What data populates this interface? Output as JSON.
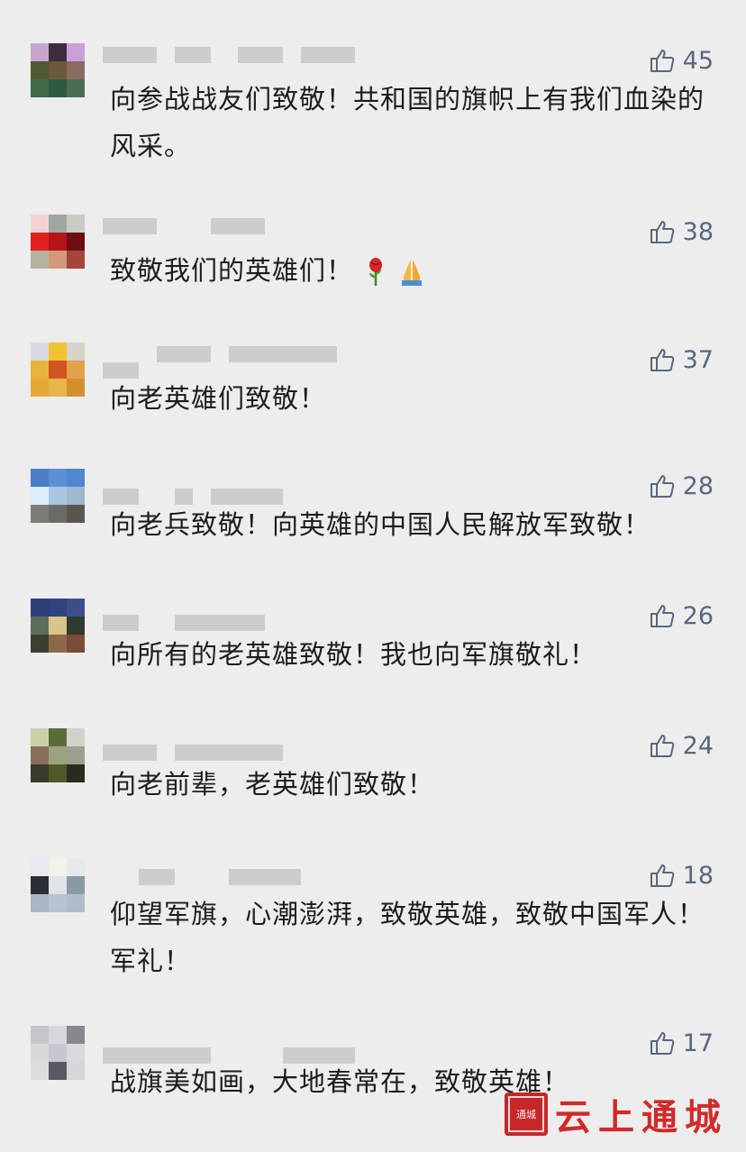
{
  "colors": {
    "background": "#ededed",
    "like": "#58667e",
    "text": "#1c1c1c",
    "watermark": "#d12a2a"
  },
  "comments": [
    {
      "likes": "45",
      "text": "向参战战友们致敬！共和国的旗帜上有我们血染的风采。",
      "emoji": []
    },
    {
      "likes": "38",
      "text": "致敬我们的英雄们！",
      "emoji": [
        "rose-emoji",
        "folded-hands-emoji"
      ]
    },
    {
      "likes": "37",
      "text": "向老英雄们致敬！",
      "emoji": []
    },
    {
      "likes": "28",
      "text": "向老兵致敬！向英雄的中国人民解放军致敬！",
      "emoji": []
    },
    {
      "likes": "26",
      "text": "向所有的老英雄致敬！我也向军旗敬礼！",
      "emoji": []
    },
    {
      "likes": "24",
      "text": "向老前辈，老英雄们致敬！",
      "emoji": []
    },
    {
      "likes": "18",
      "text": "仰望军旗，心潮澎湃，致敬英雄，致敬中国军人！军礼！",
      "emoji": []
    },
    {
      "likes": "17",
      "text": "战旗美如画，大地春常在，致敬英雄！",
      "emoji": []
    }
  ],
  "watermark": {
    "text": "云上通城",
    "seal_text": "通城"
  }
}
